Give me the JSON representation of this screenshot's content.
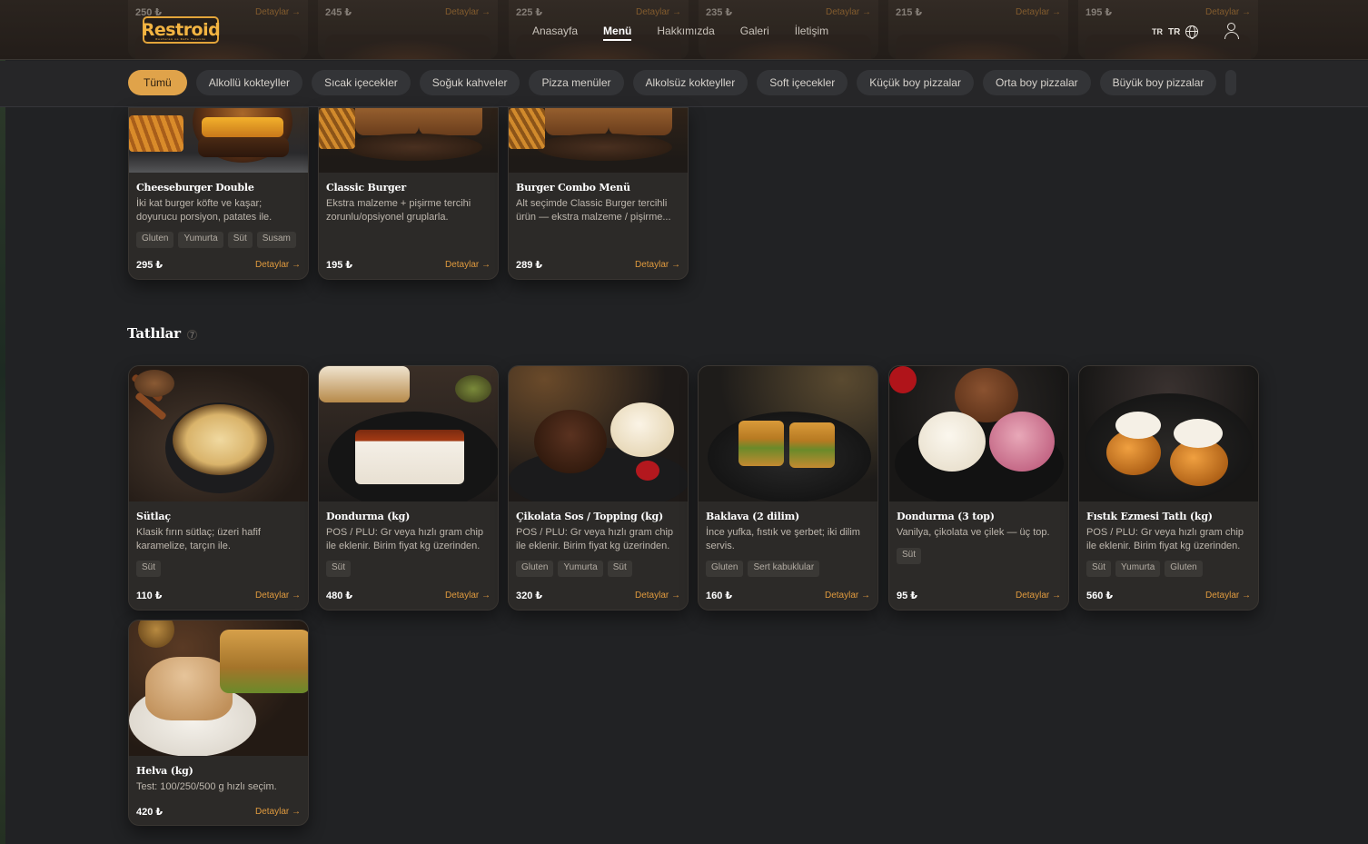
{
  "header": {
    "logo": {
      "text": "Restroid",
      "tagline": "Restoran ve Kafe Yazılımı"
    },
    "nav": [
      {
        "label": "Anasayfa",
        "active": false
      },
      {
        "label": "Menü",
        "active": true
      },
      {
        "label": "Hakkımızda",
        "active": false
      },
      {
        "label": "Galeri",
        "active": false
      },
      {
        "label": "İletişim",
        "active": false
      }
    ],
    "lang_flag": "TR",
    "lang_code": "TR",
    "icons": {
      "language": "globe-icon",
      "account": "user-icon"
    },
    "ghost_cards": [
      {
        "price": "250 ₺",
        "link": "Detaylar →"
      },
      {
        "price": "245 ₺",
        "link": "Detaylar →"
      },
      {
        "price": "225 ₺",
        "link": "Detaylar →"
      },
      {
        "price": "235 ₺",
        "link": "Detaylar →"
      },
      {
        "price": "215 ₺",
        "link": "Detaylar →"
      },
      {
        "price": "195 ₺",
        "link": "Detaylar →"
      }
    ]
  },
  "categories": [
    {
      "label": "Tümü",
      "active": true
    },
    {
      "label": "Alkollü kokteyller"
    },
    {
      "label": "Sıcak içecekler"
    },
    {
      "label": "Soğuk kahveler"
    },
    {
      "label": "Pizza menüler"
    },
    {
      "label": "Alkolsüz kokteyller"
    },
    {
      "label": "Soft içecekler"
    },
    {
      "label": "Küçük boy pizzalar"
    },
    {
      "label": "Orta boy pizzalar"
    },
    {
      "label": "Büyük boy pizzalar"
    }
  ],
  "burger_cards": [
    {
      "title": "Cheeseburger Double",
      "desc": "İki kat burger köfte ve kaşar; doyurucu porsiyon, patates ile.",
      "tags": [
        "Gluten",
        "Yumurta",
        "Süt",
        "Susam"
      ],
      "price": "295 ₺",
      "link": "Detaylar →"
    },
    {
      "title": "Classic Burger",
      "desc": "Ekstra malzeme + pişirme tercihi zorunlu/opsiyonel gruplarla.",
      "tags": [],
      "price": "195 ₺",
      "link": "Detaylar →"
    },
    {
      "title": "Burger Combo Menü",
      "desc": "Alt seçimde Classic Burger tercihli ürün — ekstra malzeme / pişirme...",
      "tags": [],
      "price": "289 ₺",
      "link": "Detaylar →"
    }
  ],
  "desserts": {
    "title": "Tatlılar",
    "count": "7",
    "items": [
      {
        "title": "Sütlaç",
        "desc": "Klasik fırın sütlaç; üzeri hafif karamelize, tarçın ile.",
        "tags": [
          "Süt"
        ],
        "price": "110 ₺",
        "link": "Detaylar →"
      },
      {
        "title": "Dondurma (kg)",
        "desc": "POS / PLU: Gr veya hızlı gram chip ile eklenir. Birim fiyat kg üzerinden.",
        "tags": [
          "Süt"
        ],
        "price": "480 ₺",
        "link": "Detaylar →"
      },
      {
        "title": "Çikolata Sos / Topping (kg)",
        "desc": "POS / PLU: Gr veya hızlı gram chip ile eklenir. Birim fiyat kg üzerinden.",
        "tags": [
          "Gluten",
          "Yumurta",
          "Süt"
        ],
        "price": "320 ₺",
        "link": "Detaylar →"
      },
      {
        "title": "Baklava (2 dilim)",
        "desc": "İnce yufka, fıstık ve şerbet; iki dilim servis.",
        "tags": [
          "Gluten",
          "Sert kabuklular"
        ],
        "price": "160 ₺",
        "link": "Detaylar →"
      },
      {
        "title": "Dondurma (3 top)",
        "desc": "Vanilya, çikolata ve çilek — üç top.",
        "tags": [
          "Süt"
        ],
        "price": "95 ₺",
        "link": "Detaylar →"
      },
      {
        "title": "Fıstık Ezmesi Tatlı (kg)",
        "desc": "POS / PLU: Gr veya hızlı gram chip ile eklenir. Birim fiyat kg üzerinden.",
        "tags": [
          "Süt",
          "Yumurta",
          "Gluten"
        ],
        "price": "560 ₺",
        "link": "Detaylar →"
      },
      {
        "title": "Helva (kg)",
        "desc": "Test: 100/250/500 g hızlı seçim.",
        "tags": [],
        "price": "420 ₺",
        "link": "Detaylar →"
      }
    ]
  },
  "colors": {
    "accent": "#e0a34a",
    "background": "#212224",
    "card": "#2c2a28",
    "link": "#e09a3e"
  }
}
